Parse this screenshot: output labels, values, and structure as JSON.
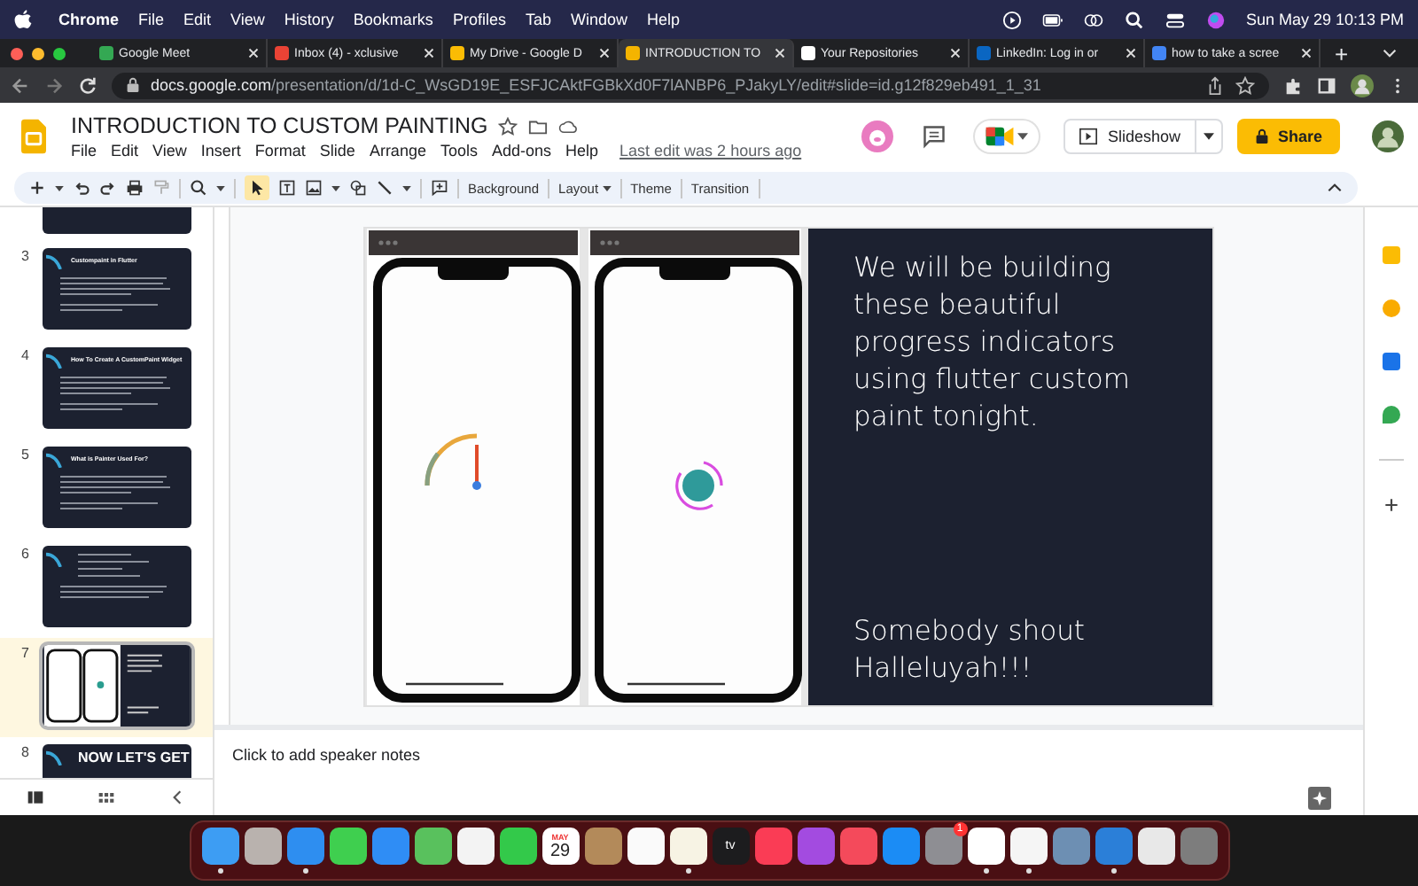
{
  "menubar": {
    "app": "Chrome",
    "menus": [
      "File",
      "Edit",
      "View",
      "History",
      "Bookmarks",
      "Profiles",
      "Tab",
      "Window",
      "Help"
    ],
    "clock": "Sun May 29  10:13 PM"
  },
  "tabs": [
    {
      "title": "Google Meet",
      "selected": false,
      "color": "#34a853"
    },
    {
      "title": "Inbox (4) - xclusive",
      "selected": false,
      "color": "#ea4335"
    },
    {
      "title": "My Drive - Google D",
      "selected": false,
      "color": "#fbbc04"
    },
    {
      "title": "INTRODUCTION TO",
      "selected": true,
      "color": "#f4b400"
    },
    {
      "title": "Your Repositories",
      "selected": false,
      "color": "#ffffff"
    },
    {
      "title": "LinkedIn: Log in or",
      "selected": false,
      "color": "#0a66c2"
    },
    {
      "title": "how to take a scree",
      "selected": false,
      "color": "#4285f4"
    }
  ],
  "new_tab": "+",
  "address": {
    "domain": "docs.google.com",
    "path": "/presentation/d/1d-C_WsGD19E_ESFJCAktFGBkXd0F7lANBP6_PJakyLY/edit#slide=id.g12f829eb491_1_31"
  },
  "doc": {
    "title": "INTRODUCTION TO CUSTOM PAINTING",
    "menus": [
      "File",
      "Edit",
      "View",
      "Insert",
      "Format",
      "Slide",
      "Arrange",
      "Tools",
      "Add-ons",
      "Help"
    ],
    "last_edit": "Last edit was 2 hours ago",
    "slideshow": "Slideshow",
    "share": "Share"
  },
  "toolbar": {
    "buttons": [
      "Background",
      "Layout",
      "Theme",
      "Transition"
    ]
  },
  "filmstrip": [
    {
      "number": "3",
      "title": "Custompaint in Flutter",
      "selected": false
    },
    {
      "number": "4",
      "title": "How To Create A CustomPaint Widget",
      "selected": false
    },
    {
      "number": "5",
      "title": "What is Painter Used For?",
      "selected": false
    },
    {
      "number": "6",
      "selected": false
    },
    {
      "number": "7",
      "selected": true
    },
    {
      "number": "8",
      "title": "NOW LET'S GET",
      "selected": false
    }
  ],
  "slide": {
    "text_top": "We will be building these beautiful progress indicators using flutter custom paint tonight.",
    "text_bottom": "Somebody shout Halleluyah!!!"
  },
  "notes": {
    "placeholder": "Click to add speaker notes"
  },
  "dock": [
    {
      "color": "#3d9df3",
      "running": true
    },
    {
      "color": "#b9b2ae",
      "running": false
    },
    {
      "color": "#2e8ef0",
      "running": true
    },
    {
      "color": "#3fcf4f",
      "running": false
    },
    {
      "color": "#2f8df5",
      "running": false
    },
    {
      "color": "#59c15d",
      "running": false
    },
    {
      "color": "#f3f3f3",
      "running": false
    },
    {
      "color": "#33c94a",
      "running": false
    },
    {
      "color": "#ffffff",
      "running": false,
      "month": "MAY",
      "day": "29"
    },
    {
      "color": "#b38a5a",
      "running": false
    },
    {
      "color": "#fafafa",
      "running": false
    },
    {
      "color": "#f7f3e4",
      "running": true
    },
    {
      "color": "#1c1c1e",
      "running": false,
      "label": "tv"
    },
    {
      "color": "#fa3c55",
      "running": false
    },
    {
      "color": "#a34be0",
      "running": false
    },
    {
      "color": "#f44a5b",
      "running": false
    },
    {
      "color": "#1b8cf5",
      "running": false
    },
    {
      "color": "#8e8e93",
      "running": false,
      "badge": "1"
    },
    {
      "color": "#ffffff",
      "running": true
    },
    {
      "color": "#f5f5f5",
      "running": true
    },
    {
      "color": "#6d8fb3",
      "running": false
    },
    {
      "color": "#2b7fd8",
      "running": true
    },
    {
      "color": "#e8e8e8",
      "running": false
    },
    {
      "color": "#7d7d7d",
      "running": false
    }
  ]
}
